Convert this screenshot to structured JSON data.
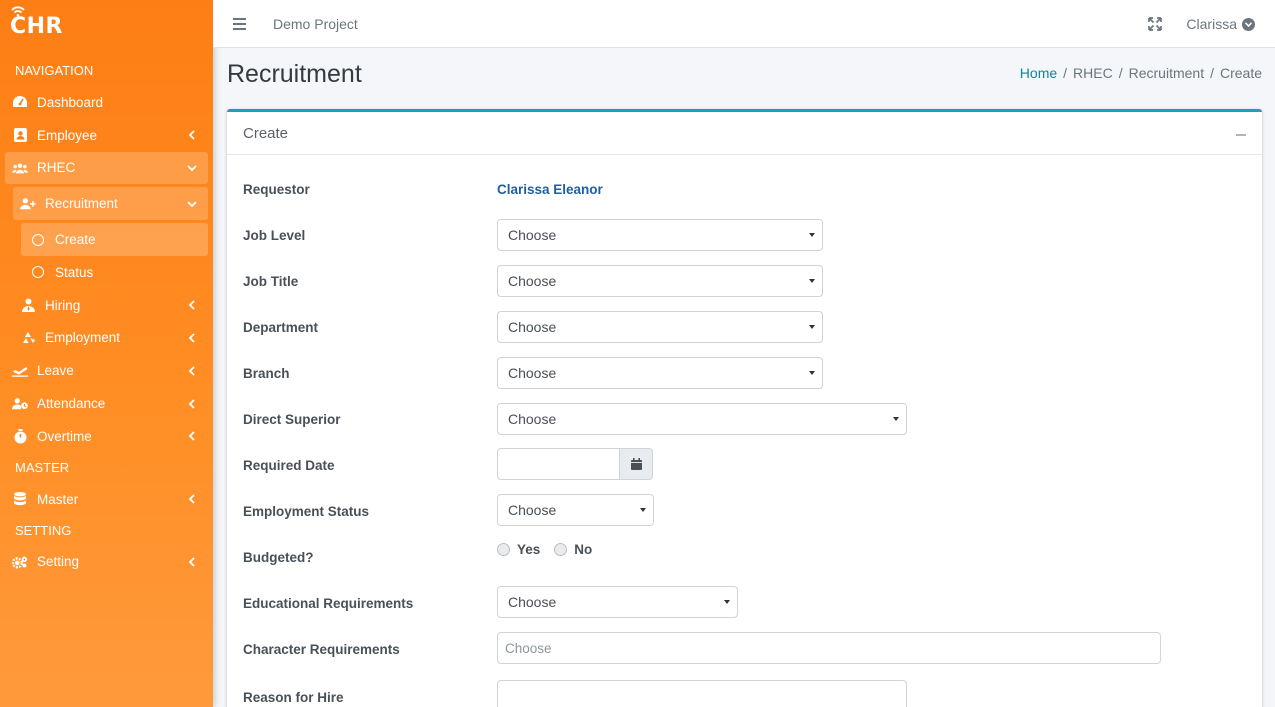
{
  "brand": {
    "name": "CHR"
  },
  "sidebar": {
    "section_navigation": "NAVIGATION",
    "section_master": "MASTER",
    "section_setting": "SETTING",
    "items": {
      "dashboard": "Dashboard",
      "employee": "Employee",
      "rhec": "RHEC",
      "recruitment": "Recruitment",
      "create": "Create",
      "status": "Status",
      "hiring": "Hiring",
      "employment": "Employment",
      "leave": "Leave",
      "attendance": "Attendance",
      "overtime": "Overtime",
      "master": "Master",
      "setting": "Setting"
    }
  },
  "topbar": {
    "project": "Demo Project",
    "user": "Clarissa"
  },
  "page": {
    "title": "Recruitment",
    "breadcrumb": {
      "home": "Home",
      "rhec": "RHEC",
      "recruitment": "Recruitment",
      "current": "Create"
    }
  },
  "card": {
    "title": "Create"
  },
  "form": {
    "requestor_label": "Requestor",
    "requestor_value": "Clarissa Eleanor",
    "job_level_label": "Job Level",
    "job_title_label": "Job Title",
    "department_label": "Department",
    "branch_label": "Branch",
    "direct_superior_label": "Direct Superior",
    "required_date_label": "Required Date",
    "employment_status_label": "Employment Status",
    "budgeted_label": "Budgeted?",
    "yes": "Yes",
    "no": "No",
    "education_label": "Educational Requirements",
    "character_label": "Character Requirements",
    "reason_label": "Reason for Hire",
    "choose": "Choose",
    "character_placeholder": "Choose"
  }
}
